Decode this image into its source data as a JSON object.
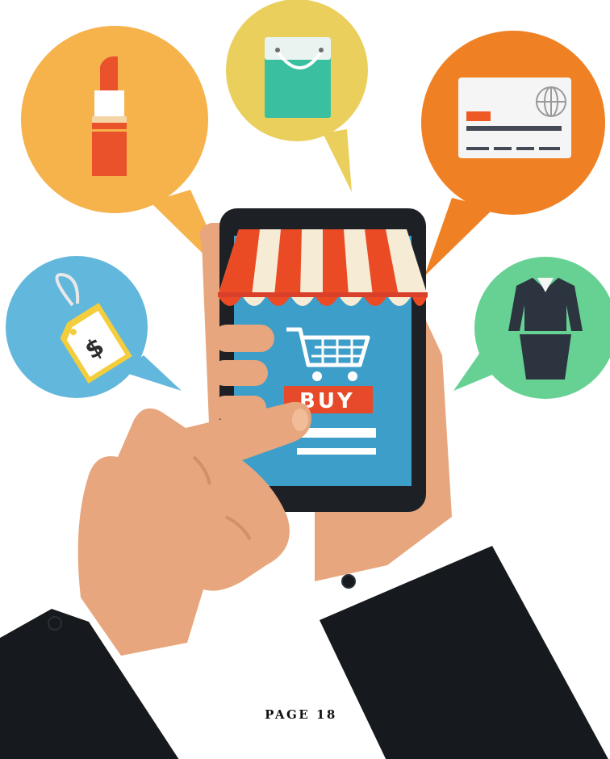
{
  "screen": {
    "button_label": "BUY",
    "price_symbol": "$"
  },
  "footer": {
    "page_label": "PAGE 18"
  },
  "icons": [
    "lipstick-icon",
    "shopping-bag-icon",
    "credit-card-icon",
    "price-tag-icon",
    "dress-icon",
    "shopping-cart-icon",
    "shop-awning-icon"
  ],
  "colors": {
    "lipstick_bubble": "#f6b24b",
    "bag_bubble": "#eacf5c",
    "card_bubble": "#ef8124",
    "tag_bubble": "#62b7dc",
    "dress_bubble": "#66d193",
    "awning_red": "#ea4b25",
    "awning_cream": "#f6ecd5",
    "screen_blue": "#3d9ec9",
    "phone_frame": "#1d2126",
    "skin": "#e7a67d",
    "sleeve": "#16191d"
  }
}
